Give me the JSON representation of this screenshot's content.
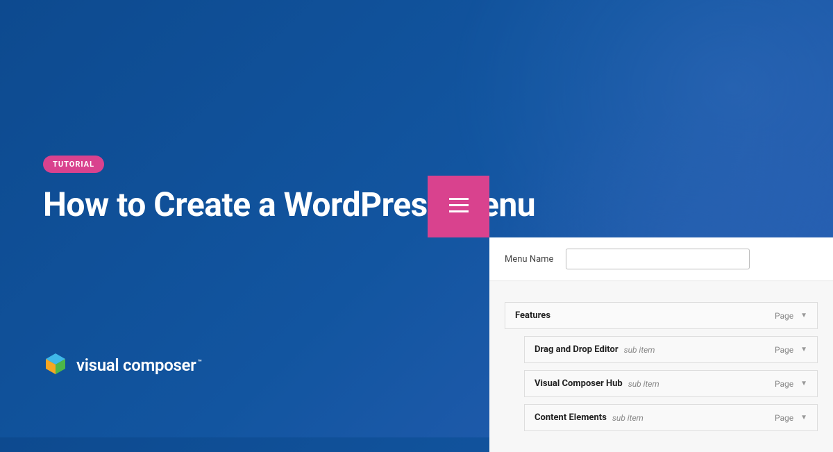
{
  "badge": "TUTORIAL",
  "title": "How to Create a WordPress Menu",
  "brand": "visual composer",
  "panel": {
    "menu_name_label": "Menu Name",
    "menu_name_value": ""
  },
  "menu_items": [
    {
      "label": "Features",
      "sub": false,
      "type": "Page"
    },
    {
      "label": "Drag and Drop Editor",
      "sub": true,
      "subtext": "sub item",
      "type": "Page"
    },
    {
      "label": "Visual Composer Hub",
      "sub": true,
      "subtext": "sub item",
      "type": "Page"
    },
    {
      "label": "Content Elements",
      "sub": true,
      "subtext": "sub item",
      "type": "Page"
    }
  ]
}
